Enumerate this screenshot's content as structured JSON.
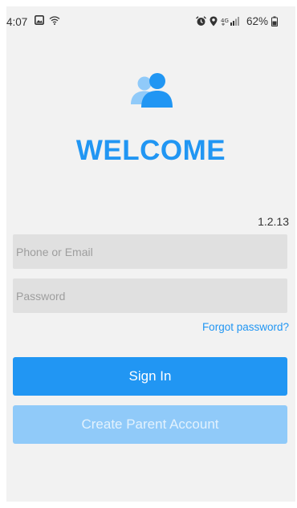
{
  "status_bar": {
    "time": "4:07",
    "battery": "62%",
    "left_icons": [
      "image-icon",
      "wifi-icon"
    ],
    "right_icons": [
      "alarm-icon",
      "location-icon",
      "signal-icon",
      "battery-icon"
    ]
  },
  "app": {
    "logo_icon": "users-icon",
    "welcome": "WELCOME",
    "version": "1.2.13"
  },
  "form": {
    "email_placeholder": "Phone or Email",
    "password_placeholder": "Password",
    "forgot_label": "Forgot password?"
  },
  "buttons": {
    "sign_in": "Sign In",
    "create_account": "Create Parent Account"
  },
  "colors": {
    "accent": "#2196f3",
    "accent_light": "#90caf9",
    "background": "#f2f2f2",
    "input_background": "#e0e0e0"
  }
}
